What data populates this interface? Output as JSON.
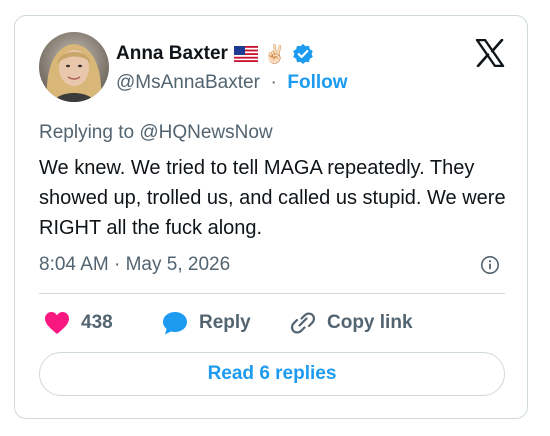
{
  "author": {
    "name": "Anna Baxter",
    "handle": "@MsAnnaBaxter",
    "separator": "·",
    "follow_label": "Follow",
    "name_emojis": [
      "us-flag",
      "victory-hand"
    ],
    "verified": true
  },
  "tweet": {
    "replying_to": "Replying to @HQNewsNow",
    "text": "We knew. We tried to tell MAGA repeatedly. They showed up, trolled us, and called us stupid. We were RIGHT all the fuck along.",
    "timestamp": "8:04 AM · May 5, 2026"
  },
  "actions": {
    "like_count": "438",
    "reply_label": "Reply",
    "copy_link_label": "Copy link"
  },
  "read_replies_label": "Read 6 replies",
  "colors": {
    "accent": "#1d9bf0",
    "like": "#f91880",
    "text": "#0f1419",
    "muted": "#536471",
    "border": "#cfd9de"
  },
  "icons": {
    "brand": "x-logo-icon",
    "verified": "verified-badge-icon",
    "like": "heart-icon",
    "reply": "speech-bubble-icon",
    "copy": "link-icon",
    "info": "info-icon"
  }
}
